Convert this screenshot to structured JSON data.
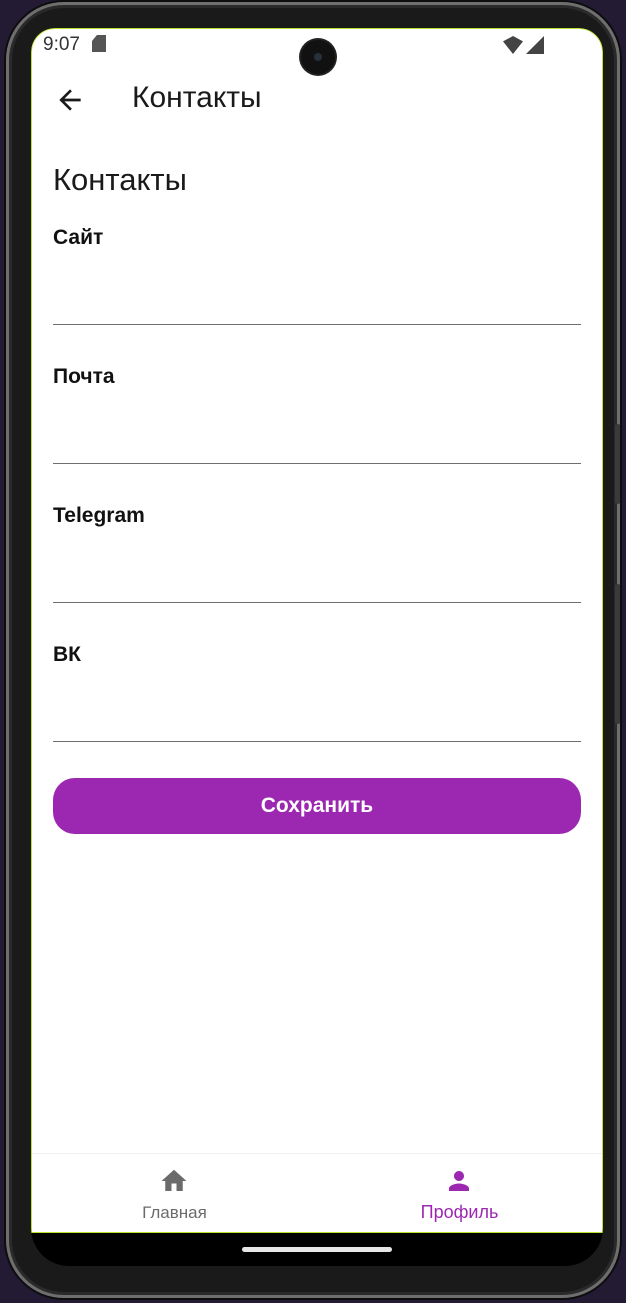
{
  "status_bar": {
    "time": "9:07"
  },
  "top_bar": {
    "back_icon": "arrow-left-icon",
    "title": "Контакты"
  },
  "section_title": "Контакты",
  "fields": [
    {
      "label": "Сайт",
      "value": ""
    },
    {
      "label": "Почта",
      "value": ""
    },
    {
      "label": "Telegram",
      "value": ""
    },
    {
      "label": "ВК",
      "value": ""
    }
  ],
  "save_button": {
    "label": "Сохранить",
    "color": "#9c27b0"
  },
  "bottom_nav": {
    "items": [
      {
        "label": "Главная",
        "icon": "home-icon",
        "active": false,
        "color": "#6b6b6b"
      },
      {
        "label": "Профиль",
        "icon": "person-icon",
        "active": true,
        "color": "#9c27b0"
      }
    ]
  }
}
